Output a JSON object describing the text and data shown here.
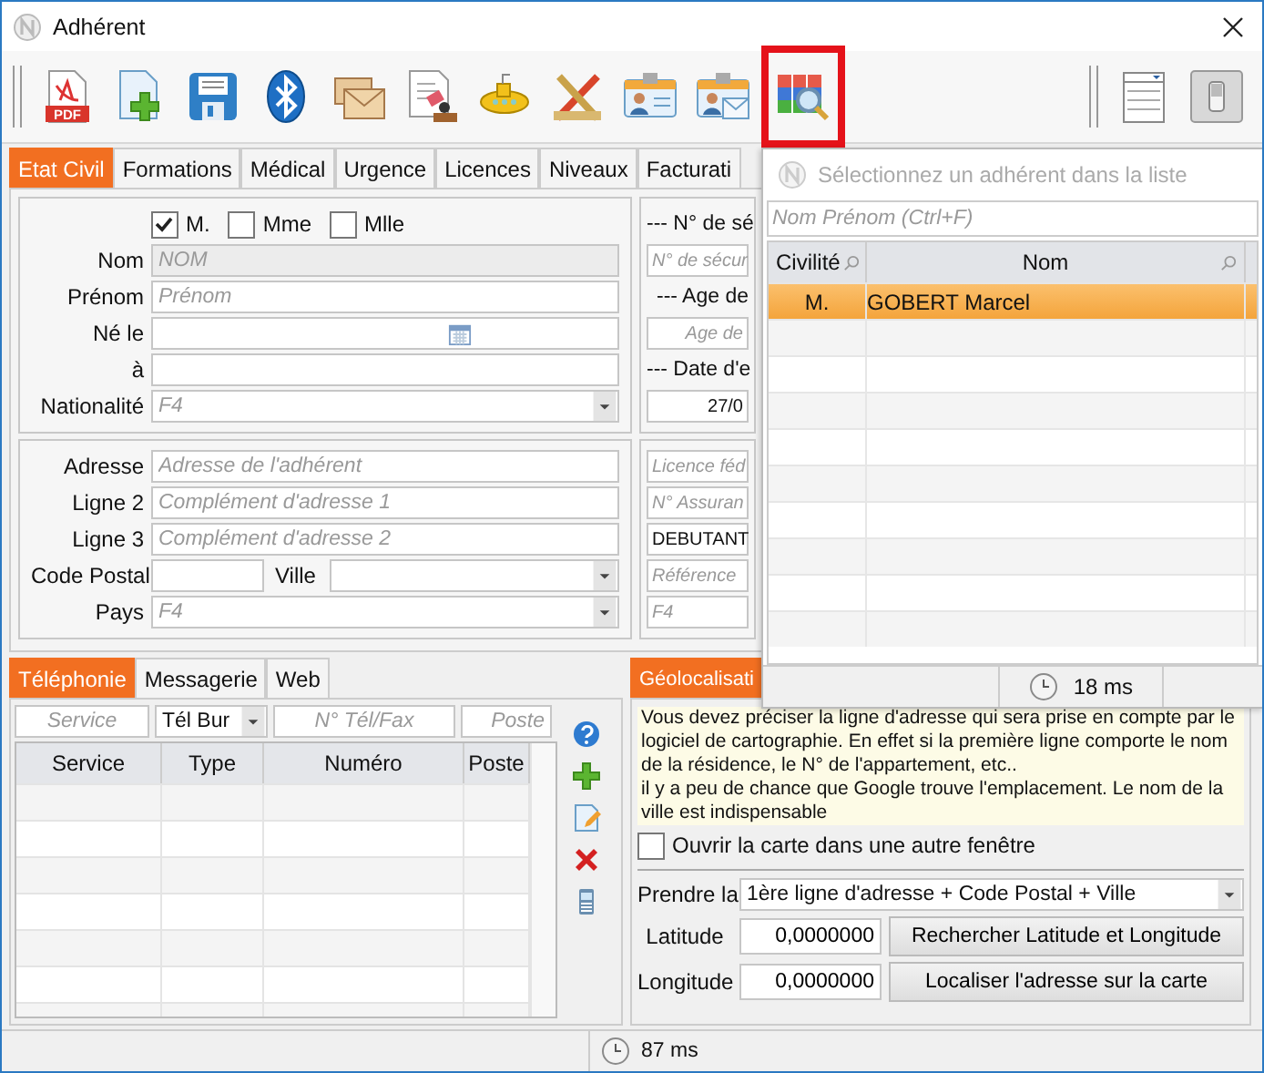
{
  "window": {
    "title": "Adhérent"
  },
  "toolbar": {
    "left": [
      {
        "kind": "pdf",
        "badge": "PDF",
        "selected": false
      },
      {
        "kind": "new",
        "selected": false
      },
      {
        "kind": "save",
        "selected": false
      },
      {
        "kind": "bluetooth",
        "selected": false
      },
      {
        "kind": "mail",
        "selected": false
      },
      {
        "kind": "stamp",
        "selected": false
      },
      {
        "kind": "submarine",
        "selected": false
      },
      {
        "kind": "tools",
        "selected": false
      },
      {
        "kind": "card",
        "selected": false
      },
      {
        "kind": "card-mail",
        "selected": false
      },
      {
        "kind": "grid-search",
        "selected": true
      }
    ],
    "right": [
      {
        "kind": "list",
        "selected": false
      },
      {
        "kind": "switch",
        "selected": false
      }
    ]
  },
  "tabs": [
    {
      "label": "Etat Civil",
      "selected": true
    },
    {
      "label": "Formations",
      "selected": false
    },
    {
      "label": "Médical",
      "selected": false
    },
    {
      "label": "Urgence",
      "selected": false
    },
    {
      "label": "Licences",
      "selected": false
    },
    {
      "label": "Niveaux",
      "selected": false
    },
    {
      "label": "Facturati",
      "selected": false
    }
  ],
  "civility": [
    {
      "label": "M.",
      "checked": true
    },
    {
      "label": "Mme",
      "checked": false
    },
    {
      "label": "Mlle",
      "checked": false
    }
  ],
  "identity": [
    {
      "label": "Nom",
      "kind": "text",
      "placeholder": "NOM",
      "disabled": true
    },
    {
      "label": "Prénom",
      "kind": "text",
      "placeholder": "Prénom",
      "disabled": false
    },
    {
      "label": "Né le",
      "kind": "date",
      "disabled": false
    },
    {
      "label": "à",
      "kind": "text",
      "disabled": false
    },
    {
      "label": "Nationalité",
      "kind": "combo",
      "placeholder": "F4",
      "disabled": false
    }
  ],
  "address": [
    {
      "label": "Adresse",
      "kind": "text",
      "placeholder": "Adresse de l'adhérent",
      "disabled": false
    },
    {
      "label": "Ligne 2",
      "kind": "text",
      "placeholder": "Complément d'adresse 1",
      "disabled": false
    },
    {
      "label": "Ligne 3",
      "kind": "text",
      "placeholder": "Complément d'adresse 2",
      "disabled": false
    },
    {
      "label": "Code Postal",
      "kind": "postal",
      "label_2": "Ville",
      "disabled": false
    },
    {
      "label": "Pays",
      "kind": "combo",
      "placeholder": "F4",
      "disabled": false
    }
  ],
  "identity_side": [
    {
      "kind": "heading",
      "text": "--- N° de sé"
    },
    {
      "kind": "text",
      "placeholder": "N° de sécur"
    },
    {
      "kind": "heading",
      "text": "--- Age de"
    },
    {
      "kind": "number",
      "placeholder": "Age de"
    },
    {
      "kind": "heading",
      "text": "--- Date d'e"
    },
    {
      "kind": "number",
      "value": "27/0"
    }
  ],
  "address_side": [
    {
      "kind": "text",
      "placeholder": "Licence féd"
    },
    {
      "kind": "text",
      "placeholder": "N° Assuran"
    },
    {
      "kind": "text",
      "value": "DEBUTANT"
    },
    {
      "kind": "text",
      "placeholder": "Référence"
    },
    {
      "kind": "text",
      "placeholder": "F4"
    }
  ],
  "contact_tabs": [
    {
      "label": "Téléphonie",
      "selected": true
    },
    {
      "label": "Messagerie",
      "selected": false
    },
    {
      "label": "Web",
      "selected": false
    }
  ],
  "phone_entry": {
    "service_placeholder": "Service",
    "type_value": "Tél Bur",
    "number_placeholder": "N° Tél/Fax",
    "extension_placeholder": "Poste"
  },
  "phone_table": {
    "columns": [
      "Service",
      "Type",
      "Numéro",
      "Poste"
    ]
  },
  "phone_actions": [
    {
      "kind": "help"
    },
    {
      "kind": "add"
    },
    {
      "kind": "edit"
    },
    {
      "kind": "delete"
    },
    {
      "kind": "phone"
    }
  ],
  "geo": {
    "tab": "Géolocalisati",
    "note": "Vous devez préciser la ligne d'adresse qui sera prise en compte par le logiciel de cartographie. En effet si la première ligne comporte le nom de la résidence, le N° de l'appartement, etc..\nil y a peu de chance que Google trouve l'emplacement. Le nom de la ville est indispensable",
    "open_in_window": {
      "label": "Ouvrir la carte dans une autre fenêtre",
      "checked": false
    },
    "take_label": "Prendre la",
    "take_value": "1ère ligne d'adresse + Code Postal + Ville",
    "latitude_label": "Latitude",
    "latitude": "0,0000000",
    "search_button": "Rechercher Latitude et Longitude",
    "longitude_label": "Longitude",
    "longitude": "0,0000000",
    "locate_button": "Localiser l'adresse sur la carte"
  },
  "status_bar": {
    "time": "87 ms"
  },
  "picker": {
    "title": "Sélectionnez un adhérent dans la liste",
    "search_placeholder": "Nom Prénom (Ctrl+F)",
    "columns": [
      "Civilité",
      "Nom"
    ],
    "rows": [
      {
        "civility": "M.",
        "name": "GOBERT Marcel",
        "selected": true
      }
    ],
    "status": "18 ms"
  }
}
